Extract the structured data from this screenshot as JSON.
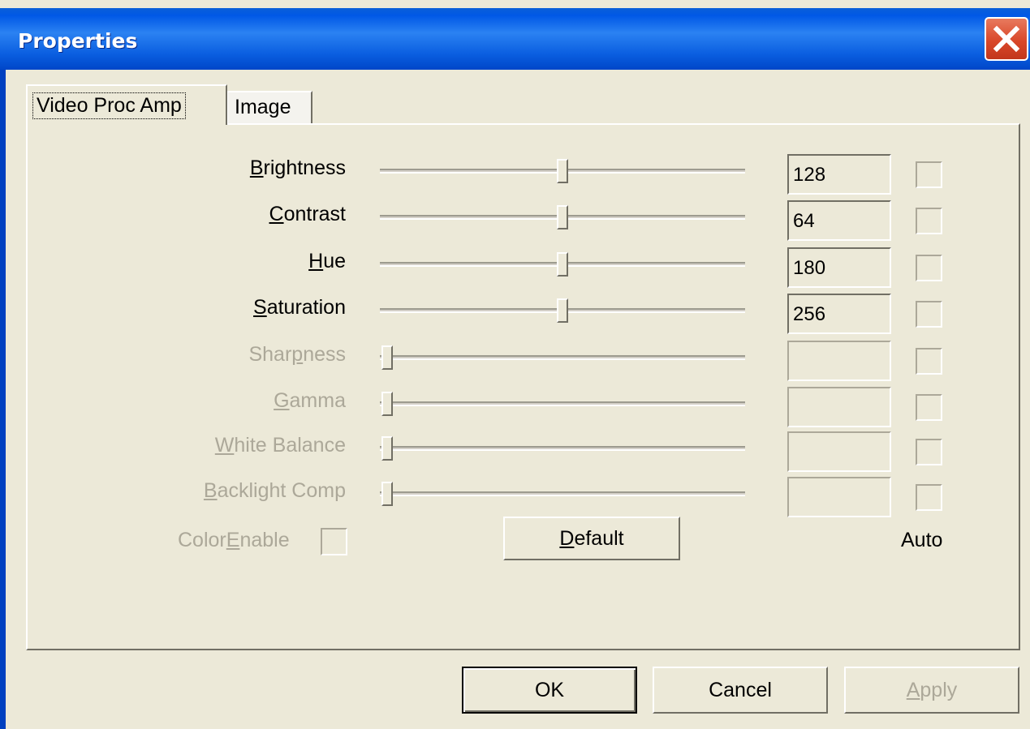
{
  "window": {
    "title": "Properties"
  },
  "tabs": [
    {
      "label": "Video Proc Amp",
      "active": true
    },
    {
      "label": "Image",
      "active": false
    }
  ],
  "rows": [
    {
      "name": "brightness",
      "label_mn": "B",
      "label_rest": "rightness",
      "value": "128",
      "enabled": true,
      "slider_fraction": 0.5
    },
    {
      "name": "contrast",
      "label_mn": "C",
      "label_rest": "ontrast",
      "value": "64",
      "enabled": true,
      "slider_fraction": 0.5
    },
    {
      "name": "hue",
      "label_mn": "H",
      "label_rest": "ue",
      "value": "180",
      "enabled": true,
      "slider_fraction": 0.5
    },
    {
      "name": "saturation",
      "label_mn": "S",
      "label_rest": "aturation",
      "value": "256",
      "enabled": true,
      "slider_fraction": 0.5
    },
    {
      "name": "sharpness",
      "label_pre": "Shar",
      "label_mn": "p",
      "label_rest": "ness",
      "value": "",
      "enabled": false,
      "slider_fraction": 0
    },
    {
      "name": "gamma",
      "label_mn": "G",
      "label_rest": "amma",
      "value": "",
      "enabled": false,
      "slider_fraction": 0
    },
    {
      "name": "white-balance",
      "label_mn": "W",
      "label_rest": "hite Balance",
      "value": "",
      "enabled": false,
      "slider_fraction": 0
    },
    {
      "name": "backlight-comp",
      "label_mn": "B",
      "label_rest": "acklight Comp",
      "value": "",
      "enabled": false,
      "slider_fraction": 0
    }
  ],
  "colorenable": {
    "label_pre": "Color",
    "label_mn": "E",
    "label_rest": "nable"
  },
  "default_button": {
    "label_mn": "D",
    "label_rest": "efault"
  },
  "auto_label": "Auto",
  "buttons": {
    "ok": "OK",
    "cancel": "Cancel",
    "apply_mn": "A",
    "apply_rest": "pply"
  },
  "colors": {
    "titlebar": "#0058e6",
    "face": "#ece9d8",
    "disabled_text": "#aca899",
    "close": "#d9482a"
  }
}
